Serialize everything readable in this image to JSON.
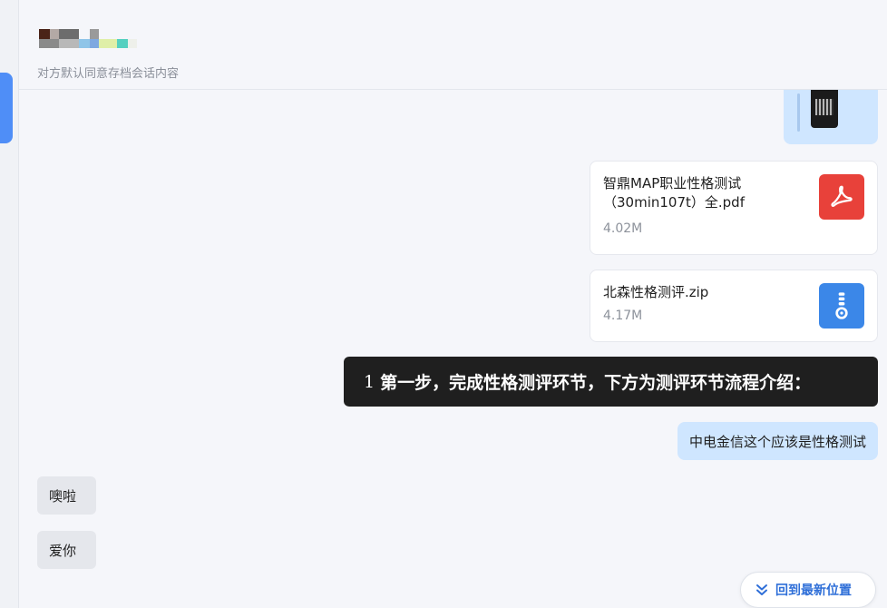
{
  "header": {
    "subtitle": "对方默认同意存档会话内容"
  },
  "messages": {
    "file1": {
      "name": "智鼎MAP职业性格测试（30min107t）全.pdf",
      "size": "4.02M",
      "icon": "pdf-icon",
      "color": "#e8413a"
    },
    "file2": {
      "name": "北森性格测评.zip",
      "size": "4.17M",
      "icon": "zip-icon",
      "color": "#3b87e8"
    },
    "caption": {
      "number": "1",
      "text": "第一步，完成性格测评环节，下方为测评环节流程介绍："
    },
    "sent_text": "中电金信这个应该是性格测试",
    "received": [
      "噢啦",
      "爱你"
    ]
  },
  "jump_button": {
    "label": "回到最新位置",
    "icon": "double-chevron-down-icon"
  }
}
